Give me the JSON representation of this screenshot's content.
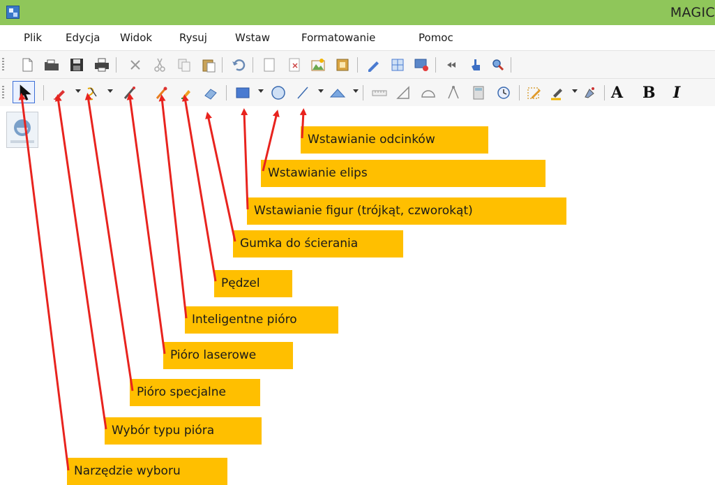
{
  "window": {
    "title": "MAGIC"
  },
  "menu": [
    "Plik",
    "Edycja",
    "Widok",
    "Rysuj",
    "Wstaw",
    "Formatowanie",
    "Pomoc"
  ],
  "format_buttons": {
    "bold": "A",
    "bold2": "B",
    "italic": "I"
  },
  "callouts": {
    "segments": "Wstawianie odcinków",
    "ellipse": "Wstawianie elips",
    "shapes": "Wstawianie figur (trójkąt, czworokąt)",
    "eraser": "Gumka do ścierania",
    "brush": "Pędzel",
    "smart_pen": "Inteligentne pióro",
    "laser_pen": "Pióro laserowe",
    "special_pen": "Pióro specjalne",
    "pen_type": "Wybór typu pióra",
    "select_tool": "Narzędzie wyboru"
  },
  "colors": {
    "titlebar": "#8fc65a",
    "callout": "#ffbf00",
    "arrow": "#e8231e"
  }
}
